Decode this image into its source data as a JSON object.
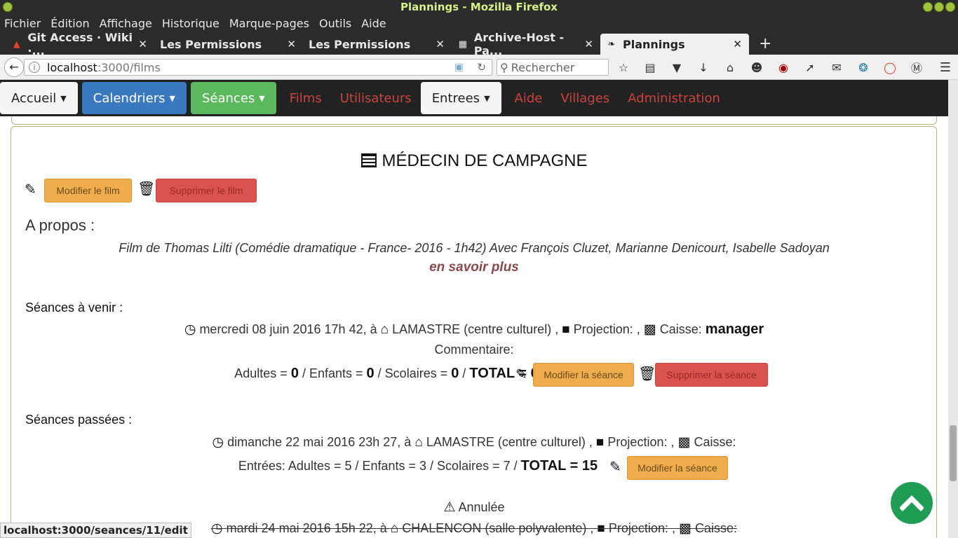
{
  "window": {
    "title": "Plannings - Mozilla Firefox"
  },
  "menubar": [
    "Fichier",
    "Édition",
    "Affichage",
    "Historique",
    "Marque-pages",
    "Outils",
    "Aide"
  ],
  "tabs": [
    {
      "label": "Git Access · Wiki ·...",
      "icon": "gitlab-icon",
      "active": false
    },
    {
      "label": "Les Permissions",
      "icon": "",
      "active": false
    },
    {
      "label": "Les Permissions",
      "icon": "",
      "active": false
    },
    {
      "label": "Archive-Host - Pa...",
      "icon": "grid-icon",
      "active": false
    },
    {
      "label": "Plannings",
      "icon": "plannings-icon",
      "active": true
    }
  ],
  "navbar": {
    "url_host": "localhost",
    "url_path": ":3000/films",
    "search_placeholder": "Rechercher"
  },
  "appnav": {
    "accueil": "Accueil",
    "calendriers": "Calendriers",
    "seances": "Séances",
    "films": "Films",
    "utilisateurs": "Utilisateurs",
    "entrees": "Entrees",
    "aide": "Aide",
    "villages": "Villages",
    "administration": "Administration"
  },
  "film": {
    "title": "MÉDECIN DE CAMPAGNE",
    "edit_label": "Modifier le film",
    "delete_label": "Supprimer le film",
    "apropos_label": "A propos :",
    "description": "Film de Thomas Lilti (Comédie dramatique - France- 2016 - 1h42) Avec François Cluzet, Marianne Denicourt, Isabelle Sadoyan",
    "more_label": "en savoir plus"
  },
  "upcoming": {
    "heading": "Séances à venir :",
    "date": "mercredi 08 juin 2016 17h 42, à",
    "place": "LAMASTRE (centre culturel) ,",
    "projection": "Projection: ,",
    "caisse_label": "Caisse:",
    "caisse_value": "manager",
    "comment": "Commentaire:",
    "adultes_label": "Adultes =",
    "adultes": "0",
    "enfants_label": "/ Enfants =",
    "enfants": "0",
    "scolaires_label": "/ Scolaires =",
    "scolaires": "0",
    "total_label": "/",
    "total": "TOTAL = 0",
    "edit_label": "Modifier la séance",
    "delete_label": "Supprimer la séance"
  },
  "past": {
    "heading": "Séances passées :",
    "date": "dimanche 22 mai 2016 23h 27, à",
    "place": "LAMASTRE (centre culturel) ,",
    "projection": "Projection: ,",
    "caisse_label": "Caisse:",
    "entries": "Entrées: Adultes = 5 / Enfants = 3 / Scolaires = 7 /",
    "total": "TOTAL = 15",
    "edit_label": "Modifier la séance",
    "cancelled": "Annulée",
    "next_date": "mardi 24 mai 2016 15h 22, à",
    "next_place": "CHALENCON (salle polyvalente) ,",
    "next_projection": "Projection: ,",
    "next_caisse": "Caisse:"
  },
  "statusbar": "localhost:3000/seances/11/edit"
}
